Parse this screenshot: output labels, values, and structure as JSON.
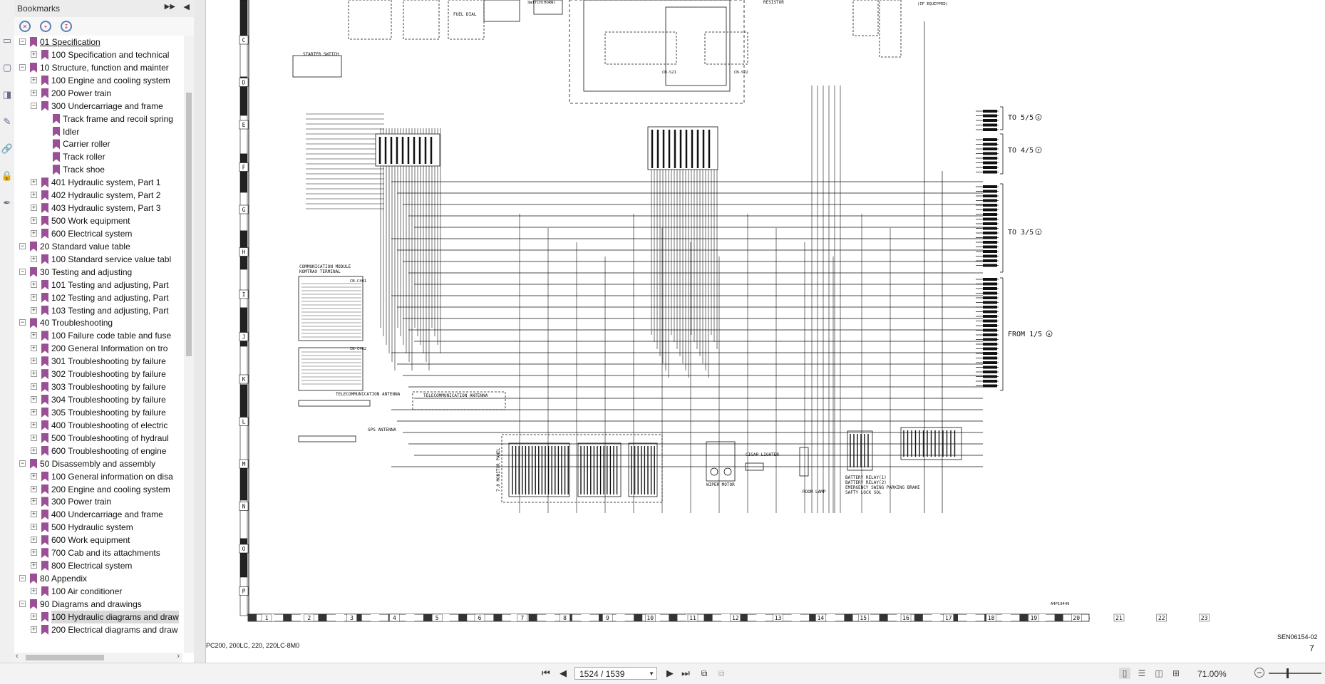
{
  "toolstrip": {
    "icons": [
      "page-thumbnails-icon",
      "page-icon",
      "layers-icon",
      "comments-icon",
      "attachments-icon",
      "security-lock-icon",
      "signatures-icon"
    ]
  },
  "bookmarks": {
    "title": "Bookmarks",
    "expand_all_symbol": "▶▶",
    "collapse_symbol": "◀",
    "toolbar_icons": [
      "delete-bookmark-icon",
      "new-bookmark-icon",
      "expand-current-bookmark-icon"
    ],
    "items": [
      {
        "label": "01 Specification",
        "level": 0,
        "toggle": "-",
        "underlined": true
      },
      {
        "label": "100 Specification and technical",
        "level": 1,
        "toggle": "+"
      },
      {
        "label": "10 Structure, function and mainter",
        "level": 0,
        "toggle": "-"
      },
      {
        "label": "100 Engine and cooling system",
        "level": 1,
        "toggle": "+"
      },
      {
        "label": "200 Power train",
        "level": 1,
        "toggle": "+"
      },
      {
        "label": "300 Undercarriage and frame",
        "level": 1,
        "toggle": "-"
      },
      {
        "label": "Track frame and recoil spring",
        "level": 2,
        "toggle": ""
      },
      {
        "label": "Idler",
        "level": 2,
        "toggle": ""
      },
      {
        "label": "Carrier roller",
        "level": 2,
        "toggle": ""
      },
      {
        "label": "Track roller",
        "level": 2,
        "toggle": ""
      },
      {
        "label": "Track shoe",
        "level": 2,
        "toggle": ""
      },
      {
        "label": "401 Hydraulic system, Part 1",
        "level": 1,
        "toggle": "+"
      },
      {
        "label": "402 Hydraulic system, Part 2",
        "level": 1,
        "toggle": "+"
      },
      {
        "label": "403 Hydraulic system, Part 3",
        "level": 1,
        "toggle": "+"
      },
      {
        "label": "500 Work equipment",
        "level": 1,
        "toggle": "+"
      },
      {
        "label": "600 Electrical system",
        "level": 1,
        "toggle": "+"
      },
      {
        "label": "20 Standard value table",
        "level": 0,
        "toggle": "-"
      },
      {
        "label": "100 Standard service value tabl",
        "level": 1,
        "toggle": "+"
      },
      {
        "label": "30 Testing and adjusting",
        "level": 0,
        "toggle": "-"
      },
      {
        "label": "101 Testing and adjusting, Part",
        "level": 1,
        "toggle": "+"
      },
      {
        "label": "102 Testing and adjusting, Part",
        "level": 1,
        "toggle": "+"
      },
      {
        "label": "103 Testing and adjusting, Part",
        "level": 1,
        "toggle": "+"
      },
      {
        "label": "40 Troubleshooting",
        "level": 0,
        "toggle": "-"
      },
      {
        "label": "100 Failure code table and fuse",
        "level": 1,
        "toggle": "+"
      },
      {
        "label": "200 General Information on tro",
        "level": 1,
        "toggle": "+"
      },
      {
        "label": "301 Troubleshooting by failure",
        "level": 1,
        "toggle": "+"
      },
      {
        "label": "302 Troubleshooting by failure",
        "level": 1,
        "toggle": "+"
      },
      {
        "label": "303 Troubleshooting by failure",
        "level": 1,
        "toggle": "+"
      },
      {
        "label": "304 Troubleshooting by failure",
        "level": 1,
        "toggle": "+"
      },
      {
        "label": "305 Troubleshooting by failure",
        "level": 1,
        "toggle": "+"
      },
      {
        "label": "400 Troubleshooting of electric",
        "level": 1,
        "toggle": "+"
      },
      {
        "label": "500 Troubleshooting of hydraul",
        "level": 1,
        "toggle": "+"
      },
      {
        "label": "600 Troubleshooting of engine",
        "level": 1,
        "toggle": "+"
      },
      {
        "label": "50 Disassembly and assembly",
        "level": 0,
        "toggle": "-"
      },
      {
        "label": "100 General information on disa",
        "level": 1,
        "toggle": "+"
      },
      {
        "label": "200 Engine and cooling system",
        "level": 1,
        "toggle": "+"
      },
      {
        "label": "300 Power train",
        "level": 1,
        "toggle": "+"
      },
      {
        "label": "400 Undercarriage and frame",
        "level": 1,
        "toggle": "+"
      },
      {
        "label": "500 Hydraulic system",
        "level": 1,
        "toggle": "+"
      },
      {
        "label": "600 Work equipment",
        "level": 1,
        "toggle": "+"
      },
      {
        "label": "700 Cab and its attachments",
        "level": 1,
        "toggle": "+"
      },
      {
        "label": "800 Electrical system",
        "level": 1,
        "toggle": "+"
      },
      {
        "label": "80 Appendix",
        "level": 0,
        "toggle": "-"
      },
      {
        "label": "100 Air conditioner",
        "level": 1,
        "toggle": "+"
      },
      {
        "label": "90 Diagrams and drawings",
        "level": 0,
        "toggle": "-"
      },
      {
        "label": "100 Hydraulic diagrams and draw",
        "level": 1,
        "toggle": "+",
        "selected": true
      },
      {
        "label": "200 Electrical diagrams and draw",
        "level": 1,
        "toggle": "+"
      }
    ]
  },
  "document": {
    "row_letters": [
      "C",
      "D",
      "E",
      "F",
      "G",
      "H",
      "I",
      "J",
      "K",
      "L",
      "M",
      "N",
      "O",
      "P"
    ],
    "column_numbers": [
      "1",
      "2",
      "3",
      "4",
      "5",
      "6",
      "7",
      "8",
      "9",
      "10",
      "11",
      "12",
      "13",
      "14",
      "15",
      "16",
      "17",
      "18",
      "19",
      "20",
      "21",
      "22",
      "23"
    ],
    "labels": {
      "starter_switch": "STARTER SWITCH",
      "fuel_dial": "FUEL DIAL",
      "switch_horn": "SWITCH(HORN)",
      "resistor": "RESISTOR",
      "if_equipped": "(IF EQUIPPED)",
      "cn_s21": "CN-S21",
      "cn_s22": "CN-S22",
      "comm_module": "COMMUNICATION MODULE",
      "kontrax": "KOMTRAX TERMINAL",
      "cn_c401": "CN-C401",
      "cn_c402": "CN-C402",
      "tele_antenna": "TELECOMMUNICATION ANTENNA",
      "tele_antenna_2": "TELECOMMUNICATION  ANTENNA",
      "gps_antenna": "GPS ANTENNA",
      "monitor_panel": "7.0 MONITOR PANEL",
      "cigar_lighter": "CIGAR LIGHTER",
      "wiper_motor": "WIPER MOTOR",
      "room_lamp": "ROOM LAMP",
      "battery_relay_1": "BATTERY RELAY(1)",
      "battery_relay_2": "BATTERY RELAY(2)",
      "emergency_brake": "EMERGENCY SWING PARKING BRAKE",
      "safty_lock": "SAFTY LOCK SOL",
      "to_5_5": "TO 5/5",
      "to_4_5": "TO 4/5",
      "to_3_5": "TO 3/5",
      "from_1_5": "FROM 1/5",
      "mark_5": "G",
      "mark_4": "F",
      "mark_3": "E",
      "mark_1": "A",
      "drawing_no": "A4P19449"
    },
    "footer_left": "PC200, 200LC, 220, 220LC-8M0",
    "footer_right": "SEN06154-02",
    "page_number": "7"
  },
  "navigation": {
    "first_symbol": "⏮",
    "prev_symbol": "◀",
    "page_display": "1524 / 1539",
    "dropdown_symbol": "▼",
    "next_symbol": "▶",
    "last_symbol": "⏭",
    "zoom": "71.00%",
    "zoom_minus": "−",
    "zoom_level": 0.35
  }
}
